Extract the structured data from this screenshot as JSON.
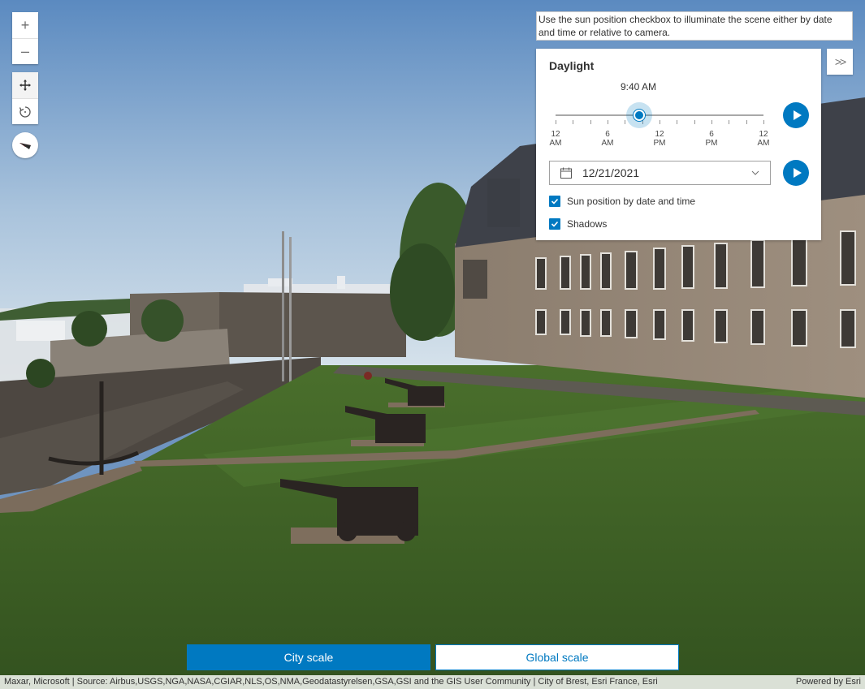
{
  "map_controls": {
    "zoom_in": "+",
    "zoom_out": "–",
    "pan_icon": "pan-move-icon",
    "rotate_icon": "rotate-icon",
    "compass_icon": "compass-icon"
  },
  "instructions": "Use the sun position checkbox to illuminate the scene either by date and time or relative to camera.",
  "collapse_icon": "double-chevron-right-icon",
  "collapse_label": ">>",
  "daylight": {
    "title": "Daylight",
    "time_label": "9:40 AM",
    "time_fraction": 0.403,
    "tick_labels": [
      {
        "top": "12",
        "bottom": "AM"
      },
      {
        "top": "6",
        "bottom": "AM"
      },
      {
        "top": "12",
        "bottom": "PM"
      },
      {
        "top": "6",
        "bottom": "PM"
      },
      {
        "top": "12",
        "bottom": "AM"
      }
    ],
    "date_value": "12/21/2021",
    "calendar_icon": "calendar-icon",
    "dropdown_icon": "chevron-down-icon",
    "play_time_icon": "play-icon",
    "play_date_icon": "play-icon",
    "checkboxes": [
      {
        "label": "Sun position by date and time",
        "checked": true
      },
      {
        "label": "Shadows",
        "checked": true
      }
    ]
  },
  "scale_buttons": {
    "city": "City scale",
    "global": "Global scale"
  },
  "attribution": {
    "sources": "Maxar, Microsoft | Source: Airbus,USGS,NGA,NASA,CGIAR,NLS,OS,NMA,Geodatastyrelsen,GSA,GSI and the GIS User Community | City of Brest, Esri France, Esri",
    "powered_by": "Powered by Esri"
  },
  "colors": {
    "accent": "#0079c1",
    "sky_top": "#5f8fc4",
    "grass": "#3f6127"
  }
}
